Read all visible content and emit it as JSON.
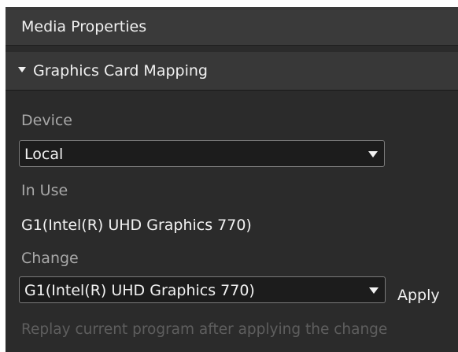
{
  "panel": {
    "title": "Media Properties"
  },
  "section": {
    "label": "Graphics Card Mapping",
    "expanded": true
  },
  "device": {
    "label": "Device",
    "selected": "Local"
  },
  "in_use": {
    "label": "In Use",
    "value": "G1(Intel(R) UHD Graphics 770)"
  },
  "change": {
    "label": "Change",
    "selected": "G1(Intel(R) UHD Graphics 770)",
    "apply_label": "Apply"
  },
  "hint": "Replay current program after applying the change",
  "colors": {
    "panel_bg": "#2b2b2b",
    "header_bg": "#3a3a3a",
    "label_gray": "#a8a8a8",
    "hint_gray": "#5e5e5e"
  }
}
